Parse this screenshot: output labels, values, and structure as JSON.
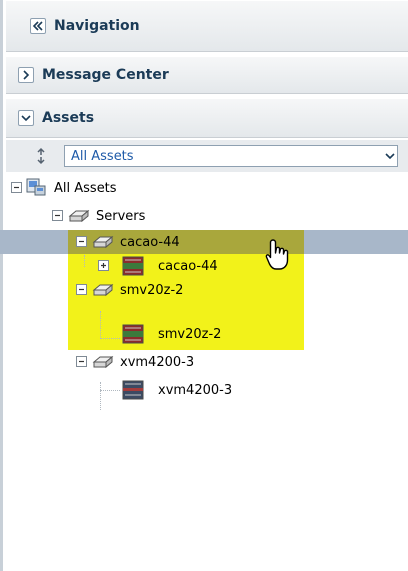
{
  "navigation": {
    "title": "Navigation"
  },
  "message_center": {
    "title": "Message Center"
  },
  "assets": {
    "title": "Assets",
    "selector": {
      "selected": "All Assets"
    }
  },
  "tree": {
    "root": "All Assets",
    "servers": "Servers",
    "nodes": [
      {
        "label": "cacao-44",
        "child": "cacao-44",
        "highlight": true,
        "selected": true
      },
      {
        "label": "smv20z-2",
        "child": "smv20z-2",
        "highlight": true,
        "selected": false
      },
      {
        "label": "xvm4200-3",
        "child": "xvm4200-3",
        "highlight": false,
        "selected": false
      }
    ]
  },
  "colors": {
    "highlight": "#f2f21a",
    "selected_row": "#a8b7c9",
    "link_blue": "#1e5aa8"
  },
  "icons": [
    "double-chevron-left-icon",
    "chevron-right-icon",
    "chevron-down-icon",
    "refresh-icon",
    "dropdown-arrow-icon",
    "expand-icon",
    "collapse-icon",
    "computer-icon",
    "server-icon",
    "hardware-icon",
    "hand-cursor-icon"
  ]
}
